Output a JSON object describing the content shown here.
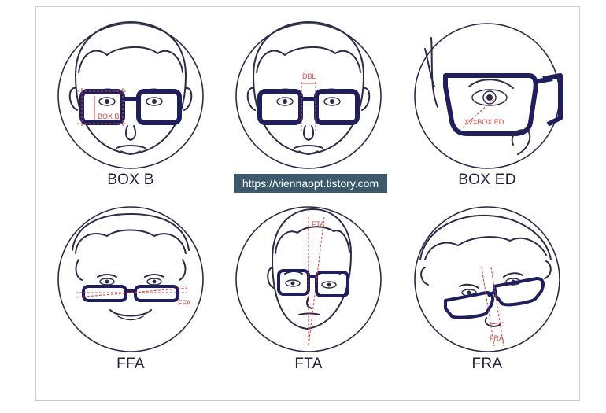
{
  "panels": [
    {
      "label": "BOX B",
      "annotation": "BOX B"
    },
    {
      "label": "",
      "annotation": "DBL"
    },
    {
      "label": "BOX ED",
      "annotation": "X2=BOX ED"
    },
    {
      "label": "FFA",
      "annotation": "FFA"
    },
    {
      "label": "FTA",
      "annotation": "FTA"
    },
    {
      "label": "FRA",
      "annotation": "FRA"
    }
  ],
  "watermark": "https://viennaopt.tistory.com",
  "colors": {
    "line": "#2a2b45",
    "frame": "#1f1f5e",
    "annotation": "#d04848"
  }
}
